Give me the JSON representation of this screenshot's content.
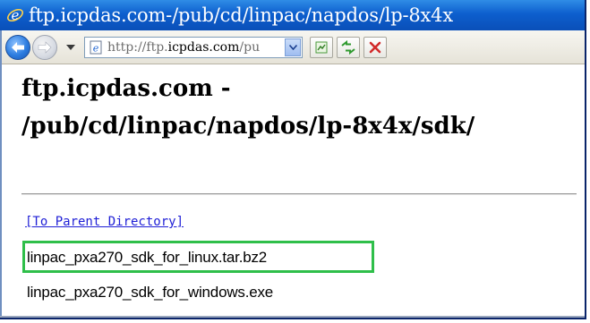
{
  "window": {
    "title": "ftp.icpdas.com-/pub/cd/linpac/napdos/lp-8x4x"
  },
  "toolbar": {
    "address": {
      "prefix": "http://ftp.",
      "host": "icpdas.com",
      "suffix": "/pu"
    },
    "icons": {
      "back": "back-arrow-icon",
      "forward": "forward-arrow-icon",
      "history": "dropdown-arrow-icon",
      "page": "ie-page-icon",
      "go": "go-page-icon",
      "refresh": "refresh-icon",
      "stop": "stop-icon"
    }
  },
  "page": {
    "heading_line1": "ftp.icpdas.com -",
    "heading_line2": "/pub/cd/linpac/napdos/lp-8x4x/sdk/",
    "parent_link": "[To Parent Directory]",
    "files": [
      "linpac_pxa270_sdk_for_linux.tar.bz2",
      "linpac_pxa270_sdk_for_windows.exe"
    ]
  },
  "colors": {
    "titlebar": "#0d5fce",
    "link": "#1f1fd6",
    "highlight": "#2fbf4a"
  }
}
